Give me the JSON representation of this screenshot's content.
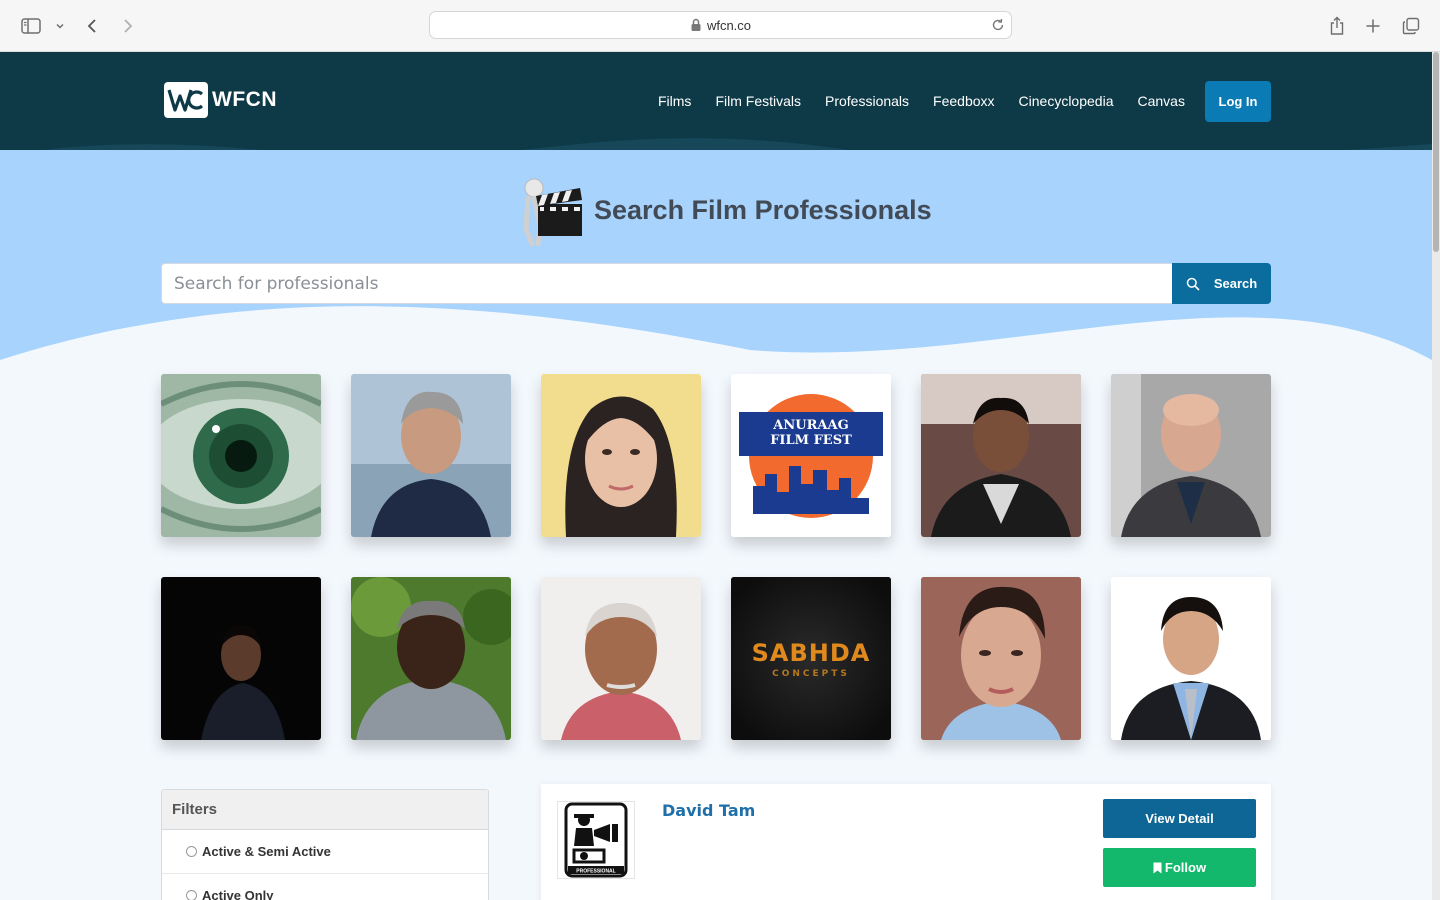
{
  "browser": {
    "url": "wfcn.co"
  },
  "header": {
    "logo_text": "WFCN",
    "nav": [
      "Films",
      "Film Festivals",
      "Professionals",
      "Feedboxx",
      "Cinecyclopedia",
      "Canvas"
    ],
    "login_label": "Log In"
  },
  "hero": {
    "title": "Search Film Professionals",
    "search_placeholder": "Search for professionals",
    "search_label": "Search"
  },
  "thumbnail_labels": {
    "anuraag_line1": "ANURAAG",
    "anuraag_line2": "FILM FEST",
    "sabhda_line1": "SABHDA",
    "sabhda_line2": "CONCEPTS"
  },
  "filters": {
    "title": "Filters",
    "options": [
      "Active & Semi Active",
      "Active Only"
    ]
  },
  "result": {
    "name": "David Tam",
    "avatar_caption": "PROFESSIONAL",
    "view_label": "View Detail",
    "follow_label": "Follow"
  },
  "colors": {
    "header_bg": "#0e3a48",
    "hero_bg": "#a7d3fd",
    "primary_button": "#0b7bb6",
    "follow_button": "#14b86c"
  }
}
